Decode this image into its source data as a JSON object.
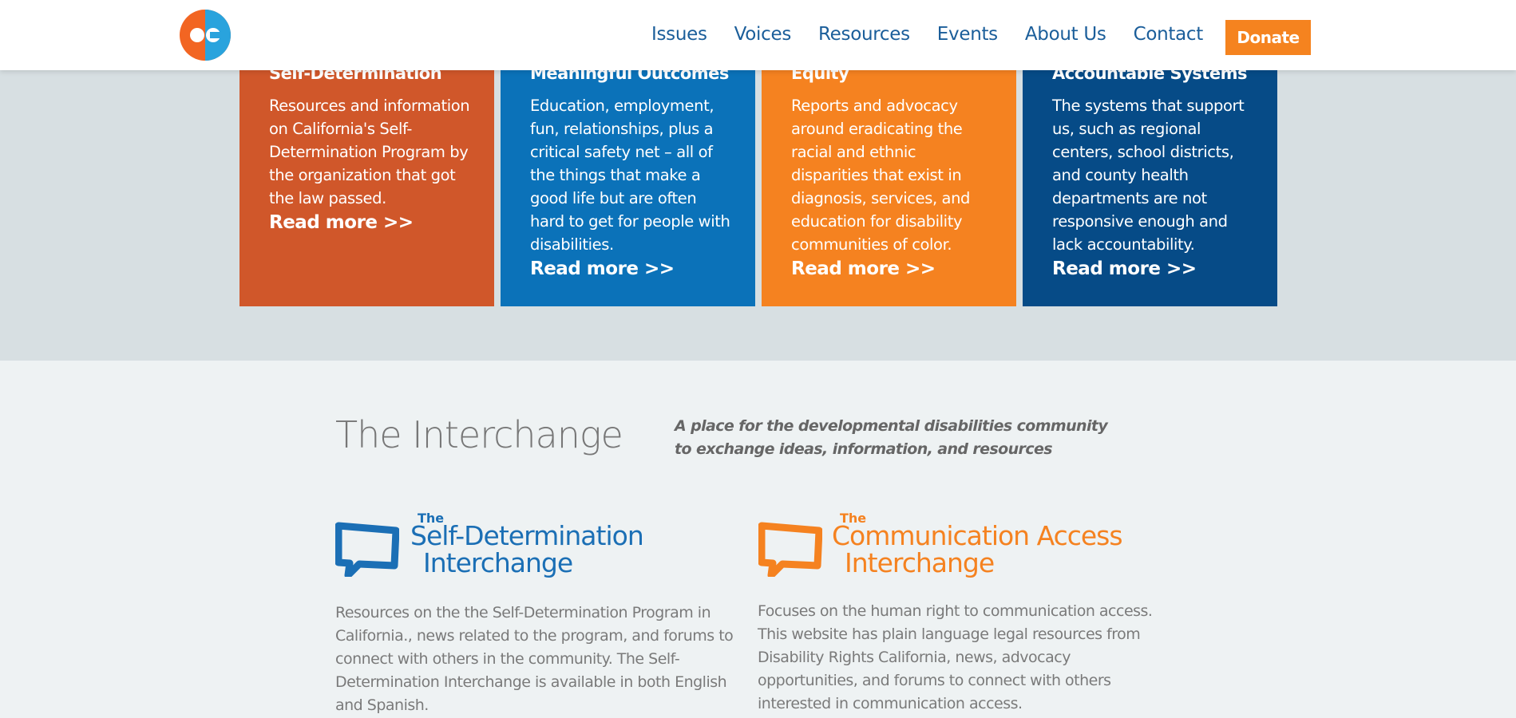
{
  "header": {
    "nav": [
      "Issues",
      "Voices",
      "Resources",
      "Events",
      "About Us",
      "Contact"
    ],
    "donate_label": "Donate"
  },
  "cards": [
    {
      "title": "Self-Determination",
      "body": "Resources and information on California's Self-Determination Program by the organization that got the law passed.",
      "link": "Read more >>",
      "color": "#d0572a"
    },
    {
      "title": "Meaningful Outcomes",
      "body": "Education, employment, fun, relationships, plus a critical safety net – all of the things that make a good life but are often hard to get for people with disabilities.",
      "link": "Read more >>",
      "color": "#0b72b9"
    },
    {
      "title": "Equity",
      "body": "Reports and advocacy around eradicating the racial and ethnic disparities that exist in diagnosis, services, and education for disability communities of color.",
      "link": "Read more >>",
      "color": "#f58220"
    },
    {
      "title": "Accountable Systems",
      "body": "The systems that support us, such as regional centers, school districts, and county health departments are not responsive enough and lack accountability.",
      "link": "Read more >>",
      "color": "#064b87"
    }
  ],
  "interchange": {
    "title": "The Interchange",
    "tagline": "A place for the developmental disabilities community to exchange ideas, information, and resources",
    "items": [
      {
        "logo_small": "The",
        "logo_line1": "Self-Determination",
        "logo_line2": "Interchange",
        "color": "#1b6fb5",
        "description": "Resources on the the Self-Determination Program in California., news related to the program, and forums to connect with others in the community. The Self-Determination Interchange is available in both English and Spanish."
      },
      {
        "logo_small": "The",
        "logo_line1": "Communication Access",
        "logo_line2": "Interchange",
        "color": "#f58220",
        "description": "Focuses on the human right to communication access. This website has plain language legal resources from Disability Rights California, news, advocacy opportunities, and forums to connect with others interested in communication access."
      }
    ]
  }
}
